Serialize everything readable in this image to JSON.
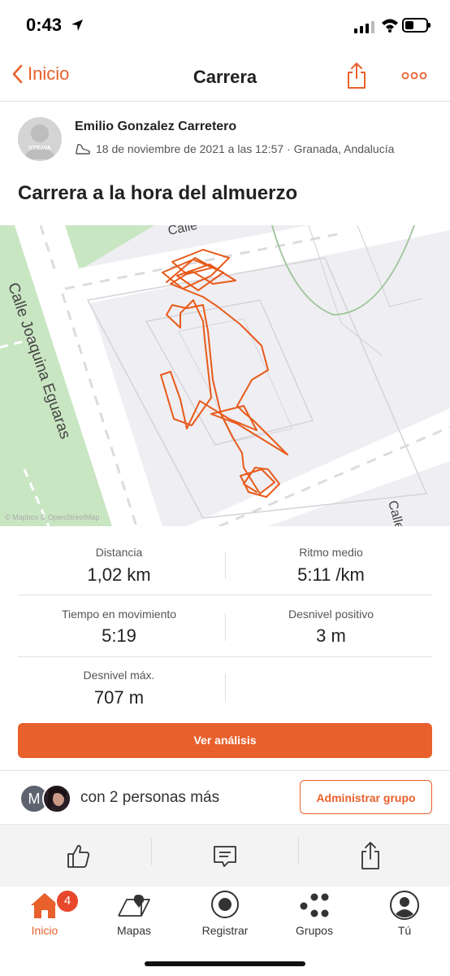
{
  "status_bar": {
    "time": "0:43"
  },
  "nav": {
    "back_label": "Inicio",
    "title": "Carrera"
  },
  "activity": {
    "athlete_name": "Emilio Gonzalez Carretero",
    "avatar_text": "STRAVA",
    "date_location": "18 de noviembre de 2021 a las 12:57 · Granada, Andalucía",
    "title": "Carrera a la hora del almuerzo"
  },
  "map": {
    "street_main": "Calle Joaquina Eguaras",
    "street_top": "Calle",
    "street_bottom_right": "Calle",
    "attribution": "© Mapbox © OpenStreetMap"
  },
  "stats": [
    {
      "label": "Distancia",
      "value": "1,02 km"
    },
    {
      "label": "Ritmo medio",
      "value": "5:11 /km"
    },
    {
      "label": "Tiempo en movimiento",
      "value": "5:19"
    },
    {
      "label": "Desnivel positivo",
      "value": "3 m"
    },
    {
      "label": "Desnivel máx.",
      "value": "707 m"
    }
  ],
  "analysis_button": "Ver análisis",
  "group": {
    "avatar_initial": "M",
    "text": "con 2 personas más",
    "manage_button": "Administrar grupo"
  },
  "actions": [
    "thumbs-up-icon",
    "comment-icon",
    "share-icon"
  ],
  "tabs": [
    {
      "label": "Inicio",
      "icon": "home-icon",
      "active": true,
      "badge": "4"
    },
    {
      "label": "Mapas",
      "icon": "map-icon"
    },
    {
      "label": "Registrar",
      "icon": "record-icon"
    },
    {
      "label": "Grupos",
      "icon": "groups-icon"
    },
    {
      "label": "Tú",
      "icon": "profile-icon"
    }
  ],
  "colors": {
    "accent": "#e8602c",
    "route": "#e85a1a",
    "badge": "#e8472c"
  }
}
